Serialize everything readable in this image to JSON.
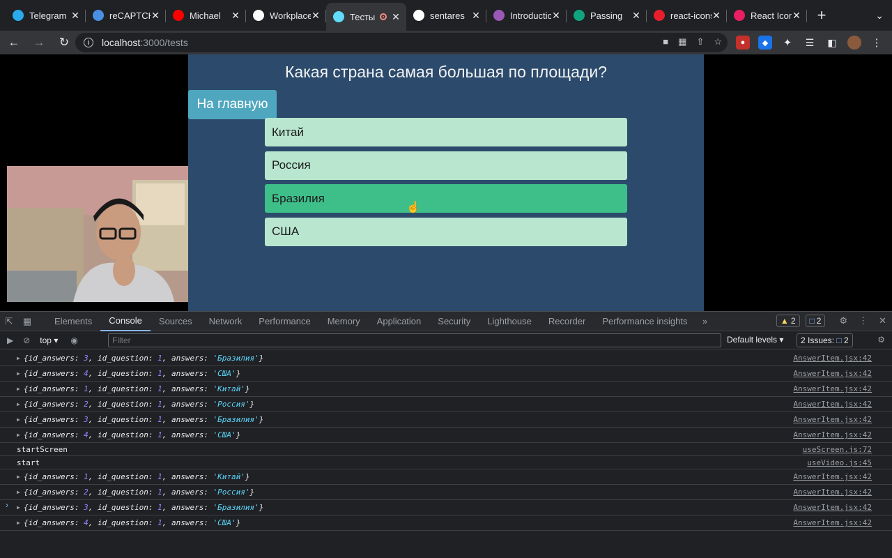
{
  "tabs": [
    {
      "title": "Telegram",
      "icon": "telegram-icon",
      "color": "#2aabee",
      "active": false
    },
    {
      "title": "reCAPTCHA",
      "icon": "recaptcha-icon",
      "color": "#4a90e2",
      "active": false
    },
    {
      "title": "Michael",
      "icon": "youtube-icon",
      "color": "#ff0000",
      "active": false
    },
    {
      "title": "Workplace",
      "icon": "workplace-icon",
      "color": "#ffffff",
      "active": false
    },
    {
      "title": "Тесты",
      "icon": "react-icon",
      "color": "#61dafb",
      "active": true
    },
    {
      "title": "sentares",
      "icon": "github-icon",
      "color": "#ffffff",
      "active": false
    },
    {
      "title": "Introduction",
      "icon": "introduction-icon",
      "color": "#9b59b6",
      "active": false
    },
    {
      "title": "Passing",
      "icon": "openai-icon",
      "color": "#10a37f",
      "active": false
    },
    {
      "title": "react-icons",
      "icon": "react-icons-icon",
      "color": "#e91e2d",
      "active": false
    },
    {
      "title": "React Icons",
      "icon": "react-icon",
      "color": "#e91e63",
      "active": false
    }
  ],
  "address": {
    "host": "localhost",
    "path": ":3000/tests"
  },
  "page": {
    "question": "Какая страна самая большая по площади?",
    "home_button": "На главную",
    "answers": [
      "Китай",
      "Россия",
      "Бразилия",
      "США"
    ],
    "hovered_answer": "Бразилия"
  },
  "devtools": {
    "tabs": [
      "Elements",
      "Console",
      "Sources",
      "Network",
      "Performance",
      "Memory",
      "Application",
      "Security",
      "Lighthouse",
      "Recorder",
      "Performance insights"
    ],
    "active_tab": "Console",
    "warnings": "2",
    "messages": "2",
    "context": "top",
    "filter_placeholder": "Filter",
    "levels": "Default levels",
    "issues": "2 Issues:",
    "issues_count": "2",
    "log": [
      {
        "type": "obj",
        "id": "3",
        "q": "1",
        "ans": "'Бразилия'",
        "src": "AnswerItem.jsx:42"
      },
      {
        "type": "obj",
        "id": "4",
        "q": "1",
        "ans": "'США'",
        "src": "AnswerItem.jsx:42"
      },
      {
        "type": "obj",
        "id": "1",
        "q": "1",
        "ans": "'Китай'",
        "src": "AnswerItem.jsx:42"
      },
      {
        "type": "obj",
        "id": "2",
        "q": "1",
        "ans": "'Россия'",
        "src": "AnswerItem.jsx:42"
      },
      {
        "type": "obj",
        "id": "3",
        "q": "1",
        "ans": "'Бразилия'",
        "src": "AnswerItem.jsx:42"
      },
      {
        "type": "obj",
        "id": "4",
        "q": "1",
        "ans": "'США'",
        "src": "AnswerItem.jsx:42"
      },
      {
        "type": "text",
        "text": "startScreen",
        "src": "useScreen.js:72"
      },
      {
        "type": "text",
        "text": "start",
        "src": "useVideo.js:45"
      },
      {
        "type": "obj",
        "id": "1",
        "q": "1",
        "ans": "'Китай'",
        "src": "AnswerItem.jsx:42"
      },
      {
        "type": "obj",
        "id": "2",
        "q": "1",
        "ans": "'Россия'",
        "src": "AnswerItem.jsx:42"
      },
      {
        "type": "obj",
        "id": "3",
        "q": "1",
        "ans": "'Бразилия'",
        "src": "AnswerItem.jsx:42"
      },
      {
        "type": "obj",
        "id": "4",
        "q": "1",
        "ans": "'США'",
        "src": "AnswerItem.jsx:42"
      }
    ]
  }
}
